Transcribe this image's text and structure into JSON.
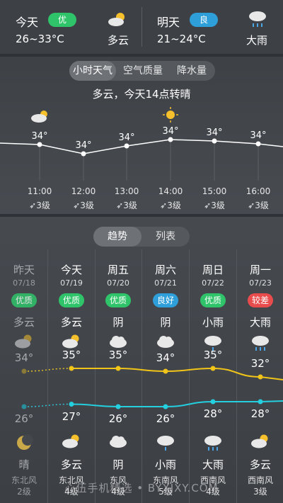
{
  "today": {
    "label": "今天",
    "aq": "优",
    "range": "26~33°C",
    "weather": "多云"
  },
  "tomorrow": {
    "label": "明天",
    "aq": "良",
    "range": "21~24°C",
    "weather": "大雨"
  },
  "hourly_tabs": [
    "小时天气",
    "空气质量",
    "降水量"
  ],
  "hourly_summary": "多云，今天14点转晴",
  "chart_data": {
    "type": "line",
    "x": [
      "11:00",
      "12:00",
      "13:00",
      "14:00",
      "15:00",
      "16:00"
    ],
    "values": [
      34,
      34,
      34,
      34,
      34,
      34
    ],
    "value_labels": [
      "34°",
      "34°",
      "34°",
      "34°",
      "34°",
      "34°"
    ],
    "wind": [
      "3级",
      "3级",
      "3级",
      "3级",
      "3级",
      "3级"
    ]
  },
  "forecast_tabs": [
    "趋势",
    "列表"
  ],
  "days": [
    {
      "wk": "昨天",
      "date": "07/18",
      "aq": "优质",
      "aq_color": "#2fc46a",
      "day": "多云",
      "high": "34°",
      "low": "26°",
      "night": "晴",
      "wind_dir": "东北风",
      "wind_lvl": "2级"
    },
    {
      "wk": "今天",
      "date": "07/19",
      "aq": "优质",
      "aq_color": "#2fc46a",
      "day": "多云",
      "high": "35°",
      "low": "27°",
      "night": "多云",
      "wind_dir": "东北风",
      "wind_lvl": "4级"
    },
    {
      "wk": "周五",
      "date": "07/20",
      "aq": "优质",
      "aq_color": "#2fc46a",
      "day": "阴",
      "high": "35°",
      "low": "26°",
      "night": "阴",
      "wind_dir": "东风",
      "wind_lvl": "4级"
    },
    {
      "wk": "周六",
      "date": "07/21",
      "aq": "良好",
      "aq_color": "#2f9fd9",
      "day": "阴",
      "high": "34°",
      "low": "26°",
      "night": "小雨",
      "wind_dir": "东南风",
      "wind_lvl": "5级"
    },
    {
      "wk": "周日",
      "date": "07/22",
      "aq": "优质",
      "aq_color": "#2fc46a",
      "day": "小雨",
      "high": "35°",
      "low": "28°",
      "night": "大雨",
      "wind_dir": "西南风",
      "wind_lvl": "4级"
    },
    {
      "wk": "周一",
      "date": "07/23",
      "aq": "较差",
      "aq_color": "#e84c4c",
      "day": "大雨",
      "high": "32°",
      "low": "28°",
      "night": "多云",
      "wind_dir": "西南风",
      "wind_lvl": "3级"
    }
  ],
  "watermark": "心伍手机精选 • BYXJXY.COM"
}
